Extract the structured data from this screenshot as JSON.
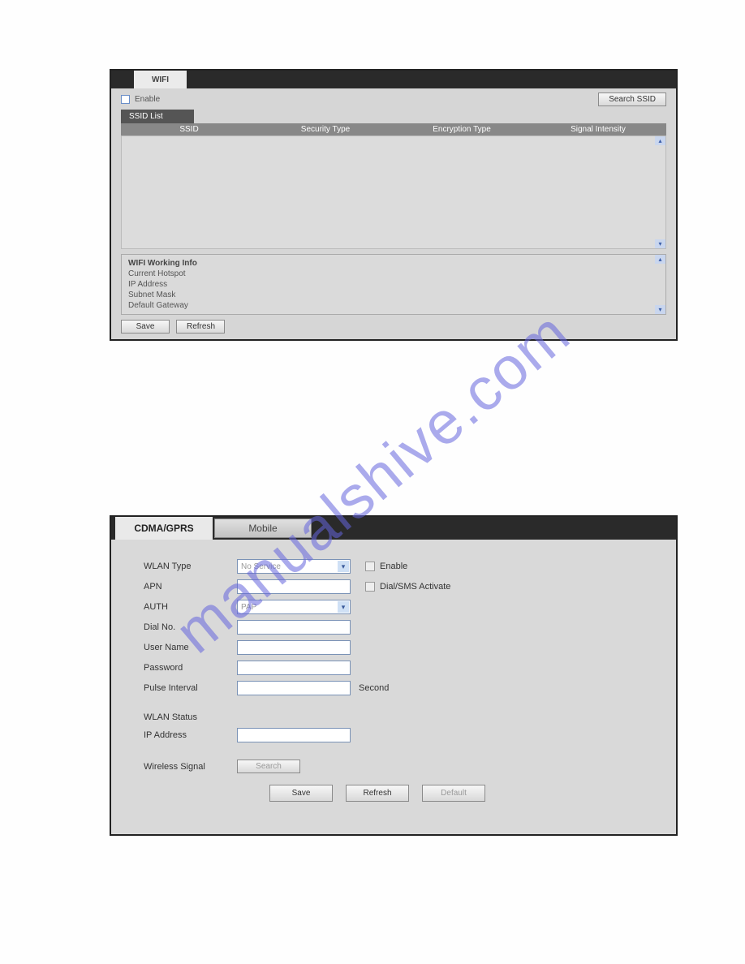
{
  "watermark": "manualshive.com",
  "panel1": {
    "tab": "WIFI",
    "enable_label": "Enable",
    "search_ssid_label": "Search SSID",
    "ssid_list_tab": "SSID List",
    "columns": {
      "ssid": "SSID",
      "security": "Security Type",
      "encryption": "Encryption Type",
      "signal": "Signal Intensity"
    },
    "working_info": {
      "title": "WIFI Working Info",
      "current_hotspot": "Current Hotspot",
      "ip_address": "IP Address",
      "subnet_mask": "Subnet Mask",
      "default_gateway": "Default Gateway"
    },
    "save_label": "Save",
    "refresh_label": "Refresh"
  },
  "panel2": {
    "tab_active": "CDMA/GPRS",
    "tab_mobile": "Mobile",
    "fields": {
      "wlan_type_label": "WLAN Type",
      "wlan_type_value": "No Service",
      "apn_label": "APN",
      "apn_value": "",
      "auth_label": "AUTH",
      "auth_value": "PAP",
      "dial_no_label": "Dial No.",
      "dial_no_value": "",
      "user_name_label": "User Name",
      "user_name_value": "",
      "password_label": "Password",
      "password_value": "",
      "pulse_interval_label": "Pulse Interval",
      "pulse_interval_value": "",
      "pulse_interval_unit": "Second",
      "wlan_status_label": "WLAN Status",
      "ip_address_label": "IP Address",
      "ip_address_value": "",
      "wireless_signal_label": "Wireless Signal"
    },
    "checkboxes": {
      "enable_label": "Enable",
      "dialsms_label": "Dial/SMS Activate"
    },
    "buttons": {
      "search": "Search",
      "save": "Save",
      "refresh": "Refresh",
      "default": "Default"
    }
  }
}
